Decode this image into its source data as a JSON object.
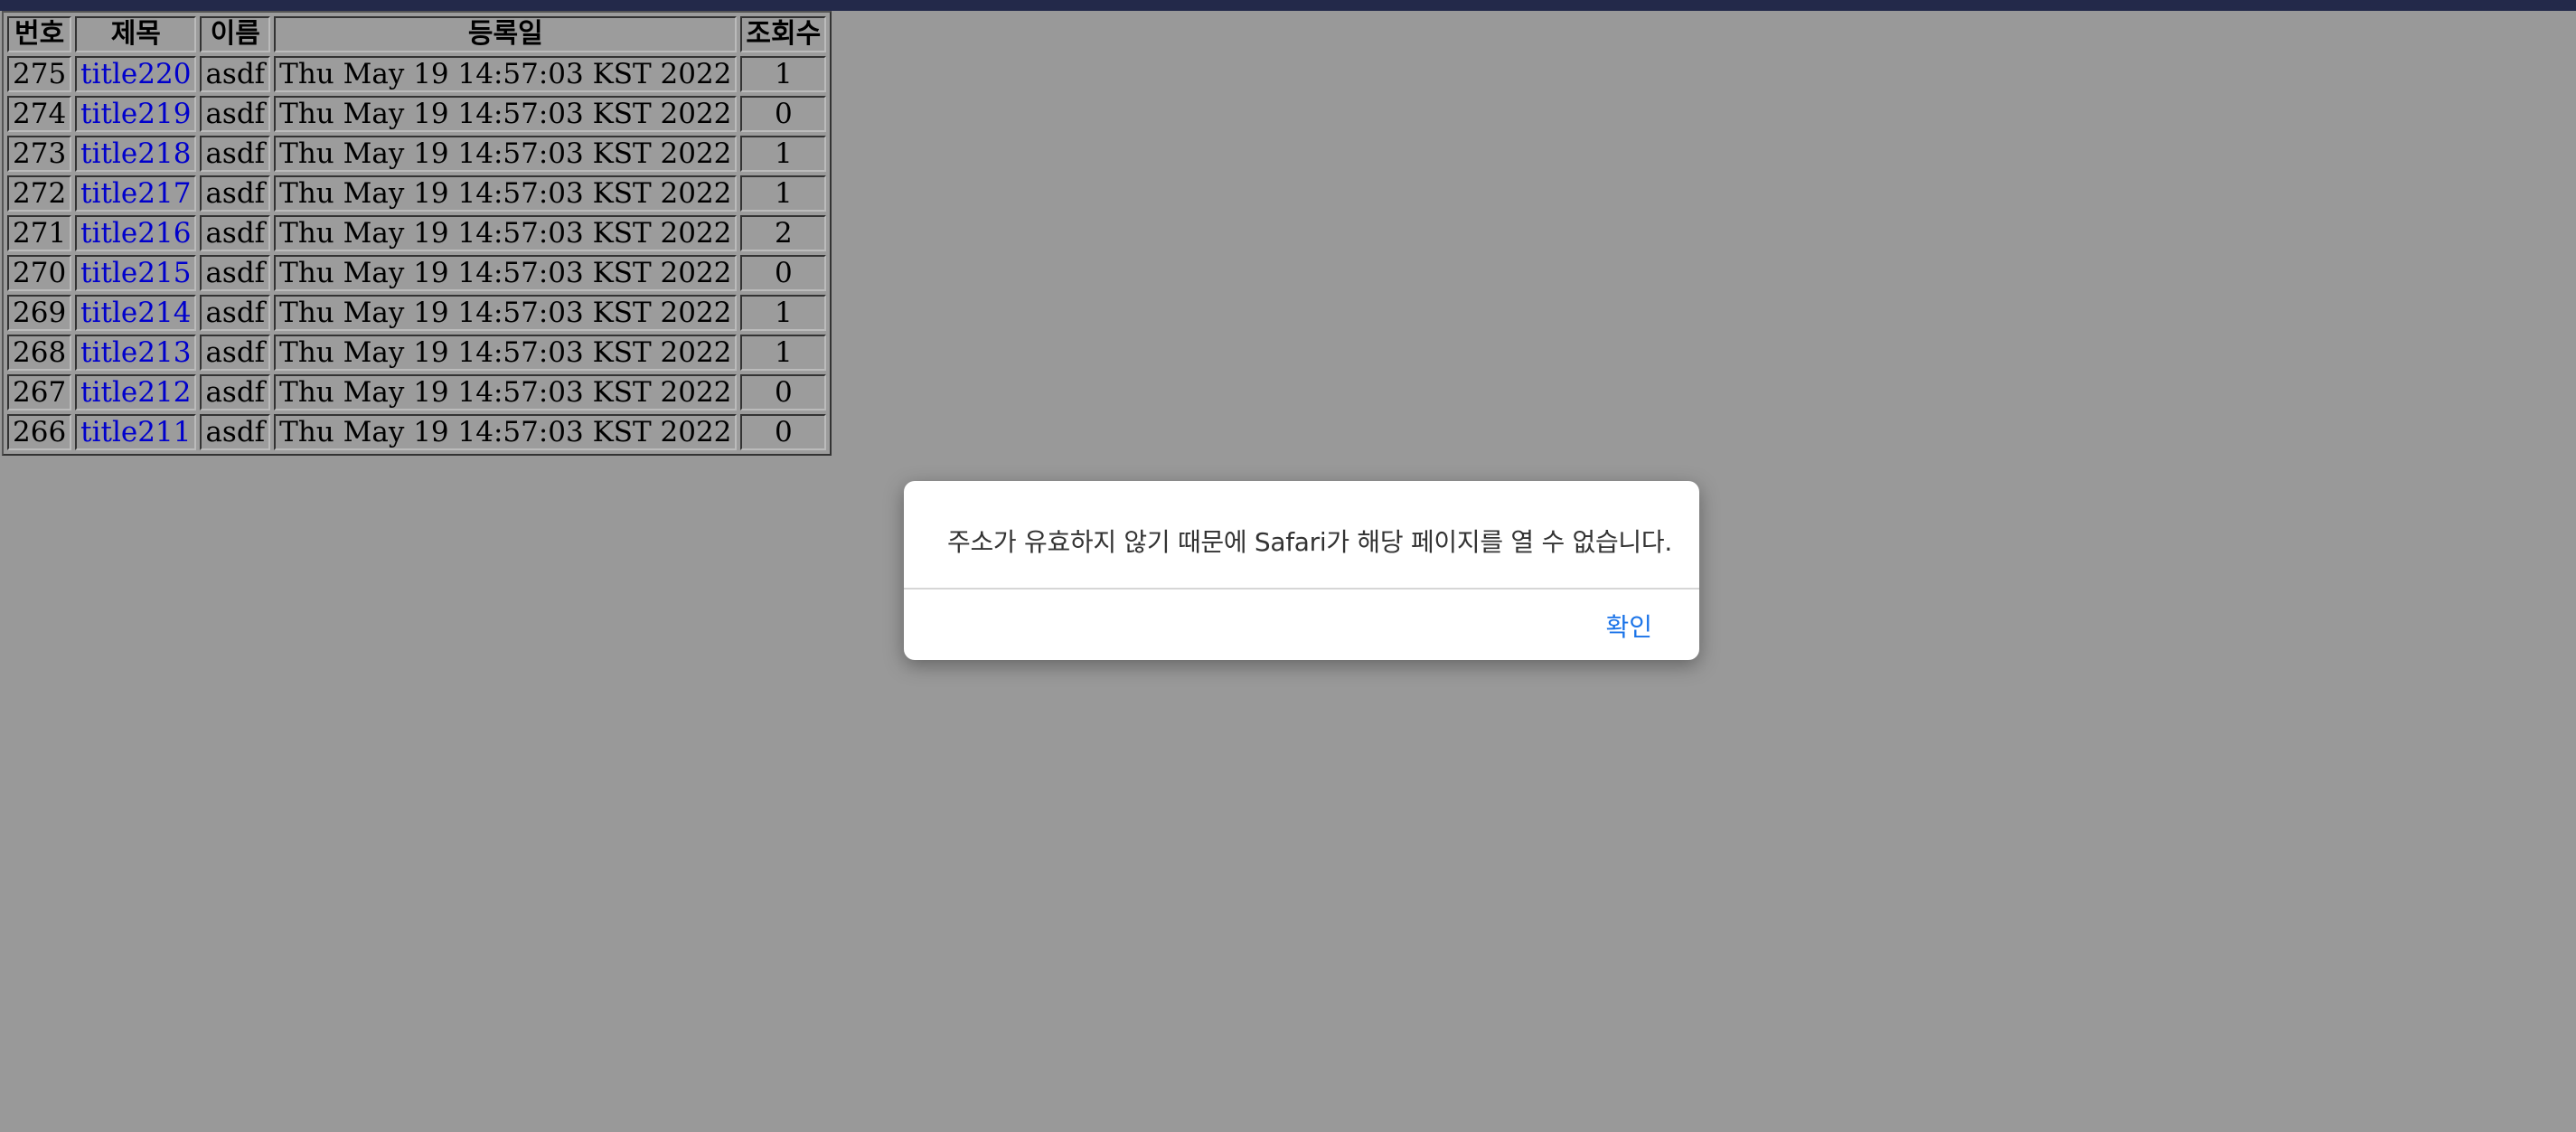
{
  "board": {
    "headers": {
      "number": "번호",
      "title": "제목",
      "name": "이름",
      "date": "등록일",
      "views": "조회수"
    },
    "rows": [
      {
        "number": "275",
        "title": "title220",
        "name": "asdf",
        "date": "Thu May 19 14:57:03 KST 2022",
        "views": "1"
      },
      {
        "number": "274",
        "title": "title219",
        "name": "asdf",
        "date": "Thu May 19 14:57:03 KST 2022",
        "views": "0"
      },
      {
        "number": "273",
        "title": "title218",
        "name": "asdf",
        "date": "Thu May 19 14:57:03 KST 2022",
        "views": "1"
      },
      {
        "number": "272",
        "title": "title217",
        "name": "asdf",
        "date": "Thu May 19 14:57:03 KST 2022",
        "views": "1"
      },
      {
        "number": "271",
        "title": "title216",
        "name": "asdf",
        "date": "Thu May 19 14:57:03 KST 2022",
        "views": "2"
      },
      {
        "number": "270",
        "title": "title215",
        "name": "asdf",
        "date": "Thu May 19 14:57:03 KST 2022",
        "views": "0"
      },
      {
        "number": "269",
        "title": "title214",
        "name": "asdf",
        "date": "Thu May 19 14:57:03 KST 2022",
        "views": "1"
      },
      {
        "number": "268",
        "title": "title213",
        "name": "asdf",
        "date": "Thu May 19 14:57:03 KST 2022",
        "views": "1"
      },
      {
        "number": "267",
        "title": "title212",
        "name": "asdf",
        "date": "Thu May 19 14:57:03 KST 2022",
        "views": "0"
      },
      {
        "number": "266",
        "title": "title211",
        "name": "asdf",
        "date": "Thu May 19 14:57:03 KST 2022",
        "views": "0"
      }
    ]
  },
  "dialog": {
    "message": "주소가 유효하지 않기 때문에 Safari가 해당 페이지를 열 수 없습니다.",
    "ok_label": "확인"
  },
  "colors": {
    "background": "#999999",
    "topbar": "#23294a",
    "link": "#0000cc",
    "dialog_button": "#1a73e8"
  }
}
